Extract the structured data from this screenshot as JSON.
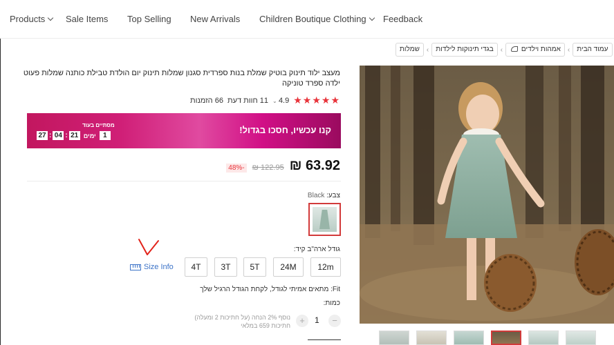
{
  "nav": {
    "products": "Products",
    "sale_items": "Sale Items",
    "top_selling": "Top Selling",
    "new_arrivals": "New Arrivals",
    "children_boutique": "Children Boutique Clothing",
    "feedback": "Feedback"
  },
  "breadcrumb": {
    "home": "עמוד הבית",
    "mother_baby": "אמהות וילדים",
    "infant_clothing": "בגדי תינוקות לילדות",
    "dresses": "שמלות"
  },
  "product": {
    "title": "מעצב ילוד תינוק בוטיק שמלת בנות ספרדית סגנון שמלות תינוק יום הולדת טבילת כותנה שמלות פעוט ילדה ספרד טוניקה",
    "stars": "★★★★★",
    "rating": "4.9",
    "reviews": "11 חוות דעת",
    "orders": "66 הזמנות"
  },
  "promo": {
    "text": "קנו עכשיו, חסכו בגדול!",
    "ends_in": "מסתיים בעוד",
    "days_value": "1",
    "days_label": "ימים",
    "hours": "21",
    "minutes": "04",
    "seconds": "27"
  },
  "price": {
    "current": "63.92 ₪",
    "original": "122.95 ₪",
    "discount": "-48%"
  },
  "color": {
    "label": "צבע:",
    "value": "Black"
  },
  "size": {
    "label": "גודל ארה\"ב קיד:",
    "options": [
      "12m",
      "24M",
      "5T",
      "3T",
      "4T"
    ],
    "info": "Size Info"
  },
  "fit": {
    "text": "Fit: מתאים אמיתי לגודל, לקחת הגודל הרגיל שלך"
  },
  "quantity": {
    "label": "כמות:",
    "value": "1",
    "plus": "+",
    "minus": "−",
    "note_line1": "נוסף 2% הנחה (על חתיכות 2 ומעלה)",
    "note_line2": "חתיכות 659 במלאי"
  },
  "colors": {
    "accent_red": "#e8333a",
    "link_blue": "#3b72c7",
    "promo_pink": "#d01f77"
  }
}
